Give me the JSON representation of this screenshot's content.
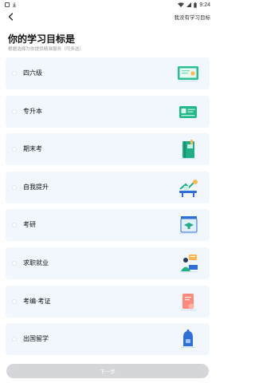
{
  "status_bar": {
    "time": "9:24"
  },
  "header": {
    "skip_label": "我没有学习目标"
  },
  "title": "你的学习目标是",
  "subtitle": "根据选择为你提供精准服务（可多选）",
  "options": [
    {
      "label": "四六级",
      "icon": "certificate-icon"
    },
    {
      "label": "专升本",
      "icon": "id-card-icon"
    },
    {
      "label": "期末考",
      "icon": "book-icon"
    },
    {
      "label": "自我提升",
      "icon": "growth-desk-icon"
    },
    {
      "label": "考研",
      "icon": "graduation-cap-icon"
    },
    {
      "label": "求职就业",
      "icon": "job-seeker-icon"
    },
    {
      "label": "考编·考证",
      "icon": "exam-document-icon"
    },
    {
      "label": "出国留学",
      "icon": "travel-bag-icon"
    }
  ],
  "next_label": "下一步",
  "colors": {
    "card_bg": "#f2f7fd",
    "accent_green": "#1fb98f",
    "button_disabled": "#d4d6da"
  }
}
